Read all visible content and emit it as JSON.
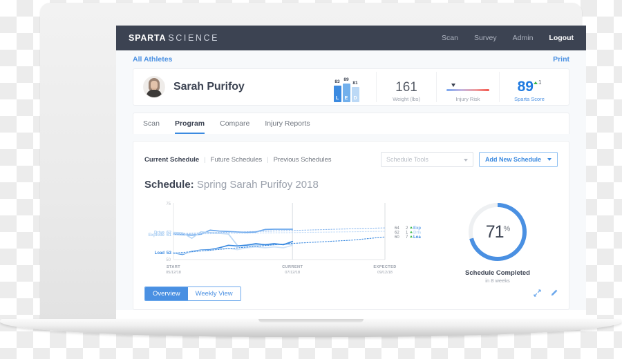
{
  "brand": {
    "bold": "SPARTA",
    "light": "SCIENCE"
  },
  "topnav": [
    {
      "label": "Scan",
      "active": false
    },
    {
      "label": "Survey",
      "active": false
    },
    {
      "label": "Admin",
      "active": false
    },
    {
      "label": "Logout",
      "active": true
    }
  ],
  "breadcrumb": {
    "left": "All Athletes",
    "right": "Print"
  },
  "profile": {
    "name": "Sarah Purifoy",
    "avatar_icon": "athlete-photo",
    "led": {
      "bars": [
        {
          "key": "L",
          "value": "83",
          "color": "#3b8ae0"
        },
        {
          "key": "E",
          "value": "89",
          "color": "#72b0ec"
        },
        {
          "key": "D",
          "value": "81",
          "color": "#bcd9f6"
        }
      ]
    },
    "weight": {
      "value": "161",
      "label": "Weight (lbs)"
    },
    "injury_risk": {
      "label": "Injury Risk"
    },
    "sparta_score": {
      "value": "89",
      "delta": "1",
      "label": "Sparta Score"
    }
  },
  "tabs": [
    {
      "label": "Scan",
      "active": false
    },
    {
      "label": "Program",
      "active": true
    },
    {
      "label": "Compare",
      "active": false
    },
    {
      "label": "Injury Reports",
      "active": false
    }
  ],
  "schedule_bar": {
    "current": "Current Schedule",
    "future": "Future Schedules",
    "previous": "Previous Schedules",
    "separator": "|",
    "tools_placeholder": "Schedule Tools",
    "add_button": "Add New Schedule"
  },
  "schedule": {
    "title_label": "Schedule:",
    "title_value": "Spring Sarah Purifoy 2018"
  },
  "donut": {
    "percent": "71",
    "percent_symbol": "%",
    "caption": "Schedule Completed",
    "subcaption": "in 8 weeks",
    "color": "#4a90e2",
    "track_color": "#eef0f2",
    "value": 71
  },
  "view_toggle": [
    {
      "label": "Overview",
      "active": true
    },
    {
      "label": "Weekly View",
      "active": false
    }
  ],
  "panel_icons": [
    {
      "name": "expand-icon"
    },
    {
      "name": "edit-pencil-icon"
    }
  ],
  "chart_data": {
    "type": "line",
    "title": "",
    "xlabel": "",
    "ylabel": "",
    "ylim": [
      50,
      75
    ],
    "y_ticks": [
      "75",
      "50"
    ],
    "grid": false,
    "legend_position": "right",
    "x_markers": [
      {
        "label": "START",
        "date": "05/12/18"
      },
      {
        "label": "CURRENT",
        "date": "07/12/18"
      },
      {
        "label": "EXPECTED",
        "date": "09/12/18"
      }
    ],
    "left_labels": [
      {
        "name": "Drive",
        "value": "62",
        "color": "#a9cdf2"
      },
      {
        "name": "Explode",
        "value": "61",
        "color": "#a9cdf2"
      },
      {
        "name": "Load",
        "value": "53",
        "color": "#3b8ae0"
      }
    ],
    "right_labels": [
      {
        "value": "64",
        "delta": "2",
        "name": "Explode",
        "color": "#6aa7ec"
      },
      {
        "value": "62",
        "delta": "1",
        "name": "Drive",
        "color": "#bcd9f6"
      },
      {
        "value": "60",
        "delta": "7",
        "name": "Load",
        "color": "#3b8ae0"
      }
    ],
    "series": [
      {
        "name": "Explode",
        "style": "solid",
        "color": "#6aa7ec",
        "values": [
          61.2,
          61.0,
          60.8,
          61.2,
          63.0,
          62.6,
          62.4,
          62.2,
          62.0,
          62.2,
          63.3,
          63.4,
          63.4,
          63.4
        ]
      },
      {
        "name": "Drive",
        "style": "solid",
        "color": "#bcd9f6",
        "values": [
          62.0,
          61.8,
          59.4,
          62.3,
          61.9,
          61.6,
          61.3,
          56.2,
          56.0,
          56.4,
          56.5,
          56.6,
          56.7,
          56.8
        ]
      },
      {
        "name": "Load",
        "style": "solid",
        "color": "#3b8ae0",
        "values": [
          53.0,
          52.3,
          53.6,
          54.2,
          54.4,
          55.2,
          56.3,
          56.0,
          56.4,
          57.0,
          56.6,
          57.0,
          56.6,
          58.0
        ]
      },
      {
        "name": "Drive-actual",
        "style": "solid",
        "color": "#cfe3f8",
        "values": [
          53.0,
          52.6,
          53.4,
          54.0,
          54.1,
          54.8,
          55.0,
          54.4,
          55.2,
          55.6,
          55.2,
          55.6,
          55.2,
          56.3
        ]
      },
      {
        "name": "Explode-projection",
        "style": "dotted",
        "color": "#8cb9ef",
        "values": [
          61.4,
          61.6,
          61.8,
          62.0,
          62.2,
          62.4,
          62.6,
          62.8,
          63.0,
          63.2,
          63.4,
          63.6,
          63.8,
          64.0
        ]
      },
      {
        "name": "Drive-projection",
        "style": "dotted",
        "color": "#c3dcf8",
        "values": [
          61.2,
          61.3,
          61.4,
          61.5,
          61.6,
          61.7,
          61.8,
          61.9,
          62.0,
          62.1,
          62.2,
          62.3,
          62.4,
          62.5
        ]
      },
      {
        "name": "Load-projection",
        "style": "dotted",
        "color": "#3b8ae0",
        "values": [
          52.8,
          53.4,
          54.0,
          54.6,
          55.2,
          55.8,
          56.4,
          57.0,
          57.4,
          57.8,
          58.2,
          58.6,
          59.3,
          60.0
        ]
      }
    ]
  }
}
